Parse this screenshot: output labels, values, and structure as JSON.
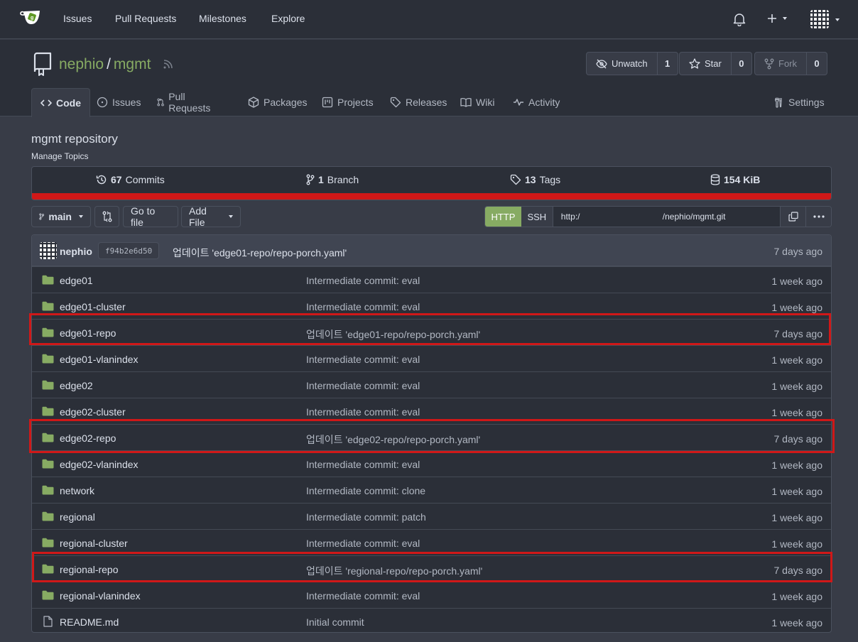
{
  "nav": {
    "links": [
      "Issues",
      "Pull Requests",
      "Milestones",
      "Explore"
    ],
    "right_icons": [
      "bell-icon",
      "plus-icon",
      "avatar"
    ]
  },
  "repo": {
    "owner": "nephio",
    "name": "mgmt",
    "watch_label": "Unwatch",
    "watch_count": "1",
    "star_label": "Star",
    "star_count": "0",
    "fork_label": "Fork",
    "fork_count": "0",
    "tabs": [
      "Code",
      "Issues",
      "Pull Requests",
      "Packages",
      "Projects",
      "Releases",
      "Wiki",
      "Activity"
    ],
    "settings_label": "Settings",
    "description": "mgmt repository",
    "manage_topics": "Manage Topics"
  },
  "stats": {
    "commits_count": "67",
    "commits_label": "Commits",
    "branch_count": "1",
    "branch_label": "Branch",
    "tags_count": "13",
    "tags_label": "Tags",
    "size": "154 KiB"
  },
  "toolbar": {
    "branch": "main",
    "go_to_file": "Go to file",
    "add_file": "Add File",
    "http": "HTTP",
    "ssh": "SSH",
    "url_left": "http:/",
    "url_right": "/nephio/mgmt.git"
  },
  "latest_commit": {
    "author": "nephio",
    "sha": "f94b2e6d50",
    "message": "업데이트 'edge01-repo/repo-porch.yaml'",
    "time": "7 days ago"
  },
  "files": [
    {
      "name": "edge01",
      "type": "folder",
      "message": "Intermediate commit: eval",
      "time": "1 week ago"
    },
    {
      "name": "edge01-cluster",
      "type": "folder",
      "message": "Intermediate commit: eval",
      "time": "1 week ago"
    },
    {
      "name": "edge01-repo",
      "type": "folder",
      "message": "업데이트 'edge01-repo/repo-porch.yaml'",
      "time": "7 days ago"
    },
    {
      "name": "edge01-vlanindex",
      "type": "folder",
      "message": "Intermediate commit: eval",
      "time": "1 week ago"
    },
    {
      "name": "edge02",
      "type": "folder",
      "message": "Intermediate commit: eval",
      "time": "1 week ago"
    },
    {
      "name": "edge02-cluster",
      "type": "folder",
      "message": "Intermediate commit: eval",
      "time": "1 week ago"
    },
    {
      "name": "edge02-repo",
      "type": "folder",
      "message": "업데이트 'edge02-repo/repo-porch.yaml'",
      "time": "7 days ago"
    },
    {
      "name": "edge02-vlanindex",
      "type": "folder",
      "message": "Intermediate commit: eval",
      "time": "1 week ago"
    },
    {
      "name": "network",
      "type": "folder",
      "message": "Intermediate commit: clone",
      "time": "1 week ago"
    },
    {
      "name": "regional",
      "type": "folder",
      "message": "Intermediate commit: patch",
      "time": "1 week ago"
    },
    {
      "name": "regional-cluster",
      "type": "folder",
      "message": "Intermediate commit: eval",
      "time": "1 week ago"
    },
    {
      "name": "regional-repo",
      "type": "folder",
      "message": "업데이트 'regional-repo/repo-porch.yaml'",
      "time": "7 days ago"
    },
    {
      "name": "regional-vlanindex",
      "type": "folder",
      "message": "Intermediate commit: eval",
      "time": "1 week ago"
    },
    {
      "name": "README.md",
      "type": "file",
      "message": "Initial commit",
      "time": "1 week ago"
    }
  ],
  "colors": {
    "accent_green": "#87ab63",
    "highlight_red": "#d01818",
    "nav_bg": "#2b2f38",
    "page_bg": "#383c47"
  }
}
